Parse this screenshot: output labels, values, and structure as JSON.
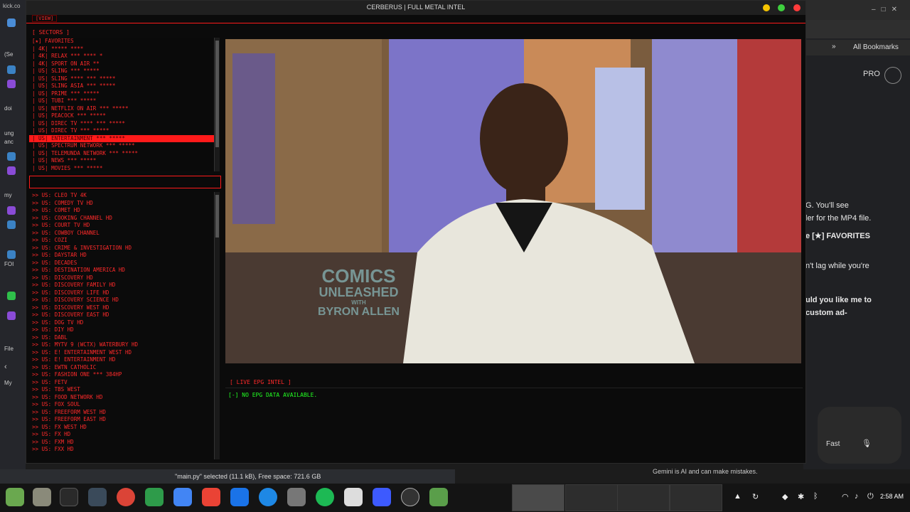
{
  "background_browser": {
    "tab_fragment": "kick.co",
    "bookmarks_label": "All Bookmarks",
    "pro_label": "PRO",
    "chat_lines": [
      {
        "text": "G. You'll see",
        "bold": false
      },
      {
        "text": "ler for the MP4 file.",
        "bold": false
      },
      {
        "text": "e [★] FAVORITES",
        "bold": true
      },
      {
        "text": "n't lag while you're",
        "bold": false
      },
      {
        "text": "uld you like me to",
        "bold": true
      },
      {
        "text": "custom ad-",
        "bold": true
      }
    ],
    "speed_mode": "Fast",
    "disclaimer": "Gemini is AI and can make mistakes."
  },
  "left_sliver": {
    "labels": [
      "(Se",
      "doi",
      "ung",
      "anc",
      "my",
      "FOI",
      "File",
      "My"
    ]
  },
  "window": {
    "title": "CERBERUS | FULL METAL INTEL",
    "menu_view": "[VIEW]",
    "controls": [
      {
        "name": "minimize",
        "color": "#f5c400"
      },
      {
        "name": "maximize",
        "color": "#3ecf3e"
      },
      {
        "name": "close",
        "color": "#ff3b3b"
      }
    ]
  },
  "sectors": {
    "header": "[ SECTORS ]",
    "items": [
      {
        "label": "[★] FAVORITES",
        "selected": false
      },
      {
        "label": "| 4K| ***** ****",
        "selected": false
      },
      {
        "label": "| 4K| RELAX *** **** *",
        "selected": false
      },
      {
        "label": "| 4K| SPORT ON AIR **",
        "selected": false
      },
      {
        "label": "| US| SLING *** *****",
        "selected": false
      },
      {
        "label": "| US| SLING **** *** *****",
        "selected": false
      },
      {
        "label": "| US| SLING ASIA *** *****",
        "selected": false
      },
      {
        "label": "| US| PRIME *** *****",
        "selected": false
      },
      {
        "label": "| US| TUBI *** *****",
        "selected": false
      },
      {
        "label": "| US| NETFLIX ON AIR *** *****",
        "selected": false
      },
      {
        "label": "| US| PEACOCK *** *****",
        "selected": false
      },
      {
        "label": "| US| DIREC TV **** *** *****",
        "selected": false
      },
      {
        "label": "| US| DIREC TV *** *****",
        "selected": false
      },
      {
        "label": "| US| ENTERTAINMENT *** *****",
        "selected": true
      },
      {
        "label": "| US| SPECTRUM NETWORK *** *****",
        "selected": false
      },
      {
        "label": "| US| TELEMUNDA NETWORK *** *****",
        "selected": false
      },
      {
        "label": "| US| NEWS *** *****",
        "selected": false
      },
      {
        "label": "| US| MOVIES *** *****",
        "selected": false
      }
    ]
  },
  "channels": {
    "items": [
      ">> US: CLEO TV 4K",
      ">> US: COMEDY TV HD",
      ">> US: COMET HD",
      ">> US: COOKING CHANNEL HD",
      ">> US: COURT TV HD",
      ">> US: COWBOY CHANNEL",
      ">> US: COZI",
      ">> US: CRIME & INVESTIGATION HD",
      ">> US: DAYSTAR HD",
      ">> US: DECADES",
      ">> US: DESTINATION AMERICA HD",
      ">> US: DISCOVERY HD",
      ">> US: DISCOVERY FAMILY HD",
      ">> US: DISCOVERY LIFE HD",
      ">> US: DISCOVERY SCIENCE HD",
      ">> US: DISCOVERY WEST HD",
      ">> US: DISCOVERY EAST HD",
      ">> US: DOG TV HD",
      ">> US: DIY HD",
      ">> US: DABL",
      ">> US: MYTV 9 (WCTX) WATERBURY HD",
      ">> US: E! ENTERTAINMENT WEST HD",
      ">> US: E! ENTERTAINMENT HD",
      ">> US: EWTN CATHOLIC",
      ">> US: FASHION ONE *** 384HP",
      ">> US: FETV",
      ">> US: TBS WEST",
      ">> US: FOOD NETWORK HD",
      ">> US: FOX SOUL",
      ">> US: FREEFORM WEST HD",
      ">> US: FREEFORM EAST HD",
      ">> US: FX WEST HD",
      ">> US: FX HD",
      ">> US: FXM HD",
      ">> US: FXX HD"
    ]
  },
  "video": {
    "watermark_line1": "COMICS",
    "watermark_line2": "UNLEASHED",
    "watermark_line3": "WITH",
    "watermark_line4": "BYRON ALLEN"
  },
  "epg": {
    "header": "[ LIVE EPG INTEL ]",
    "message": "[-] NO EPG DATA AVAILABLE."
  },
  "statusbar": {
    "text": "\"main.py\" selected (11.1 kB), Free space: 721.6 GB"
  },
  "taskbar": {
    "clock": "2:58 AM"
  }
}
